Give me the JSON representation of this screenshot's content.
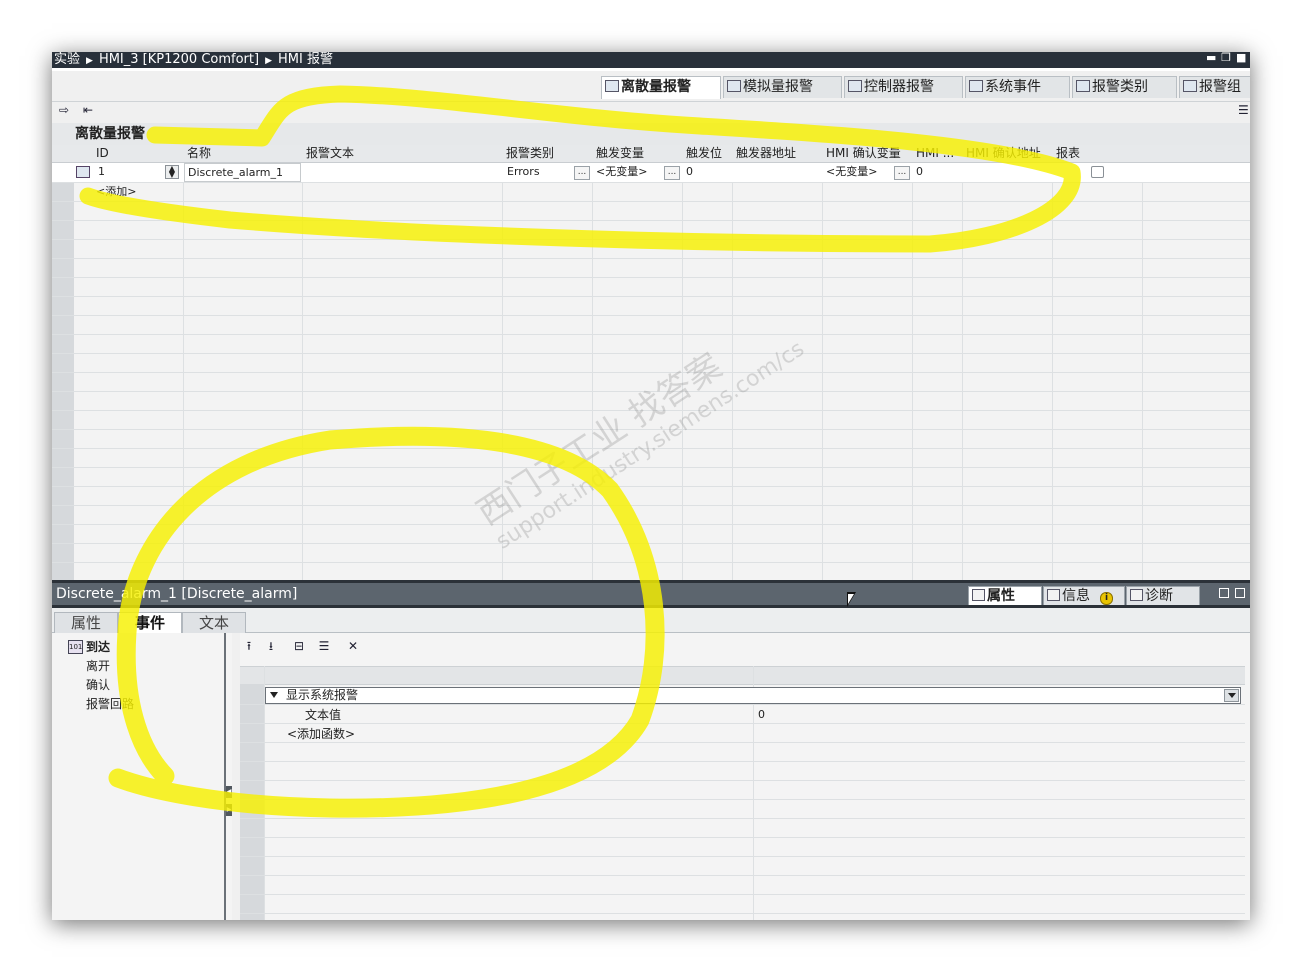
{
  "breadcrumb": [
    "实验",
    "HMI_3 [KP1200 Comfort]",
    "HMI 报警"
  ],
  "window_controls": [
    "▬",
    "❐",
    "■"
  ],
  "editor_tabs": [
    "离散量报警",
    "模拟量报警",
    "控制器报警",
    "系统事件",
    "报警类别",
    "报警组"
  ],
  "active_editor_tab": "离散量报警",
  "section_title": "离散量报警",
  "table": {
    "columns": [
      "ID",
      "名称",
      "报警文本",
      "报警类别",
      "触发变量",
      "触发位",
      "触发器地址",
      "HMI 确认变量",
      "HMI ...",
      "HMI 确认地址",
      "报表"
    ],
    "rows": [
      {
        "id": "1",
        "name": "Discrete_alarm_1",
        "text": "",
        "class": "Errors",
        "trigger_tag": "<无变量>",
        "trigger_bit": "0",
        "trigger_addr": "",
        "ack_tag": "<无变量>",
        "ack_bit": "0",
        "ack_addr": ""
      }
    ],
    "add_label": "<添加>",
    "ellipsis": "..."
  },
  "inspector": {
    "title": "Discrete_alarm_1 [Discrete_alarm]",
    "tabs": [
      "属性",
      "信息",
      "诊断"
    ],
    "info_badge": "i",
    "subtabs": [
      "属性",
      "事件",
      "文本"
    ],
    "active_subtab": "事件",
    "events": [
      "到达",
      "离开",
      "确认",
      "报警回路"
    ],
    "selected_event": "到达",
    "function": {
      "name": "显示系统报警",
      "param_label": "文本值",
      "param_value": "0",
      "add_function": "<添加函数>"
    }
  },
  "watermark": {
    "line1": "西门子工业  找答案",
    "line2": "support.industry.siemens.com/cs"
  },
  "highlight_color": "#f6f000"
}
